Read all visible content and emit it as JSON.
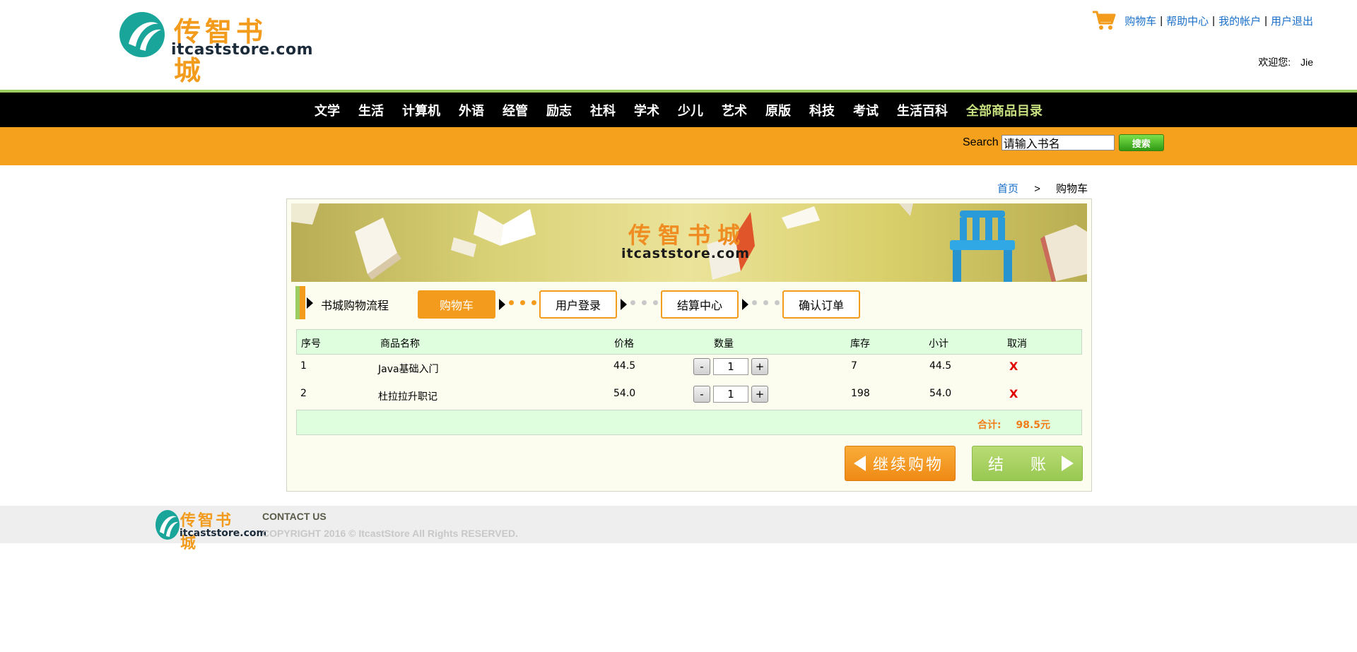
{
  "header": {
    "logo_cn": "传智书城",
    "logo_en": "itcaststore.com",
    "top_links": [
      "购物车",
      "帮助中心",
      "我的帐户",
      "用户退出"
    ],
    "welcome_label": "欢迎您:",
    "username": "Jie"
  },
  "categories": [
    "文学",
    "生活",
    "计算机",
    "外语",
    "经管",
    "励志",
    "社科",
    "学术",
    "少儿",
    "艺术",
    "原版",
    "科技",
    "考试",
    "生活百科",
    "全部商品目录"
  ],
  "search": {
    "label": "Search",
    "value": "请输入书名",
    "button": "搜索"
  },
  "breadcrumb": {
    "home": "首页",
    "separator": ">",
    "current": "购物车"
  },
  "banner": {
    "cn": "传智书城",
    "en": "itcaststore.com"
  },
  "flow": {
    "title": "书城购物流程",
    "steps": [
      "购物车",
      "用户登录",
      "结算中心",
      "确认订单"
    ]
  },
  "cart": {
    "columns": [
      "序号",
      "商品名称",
      "价格",
      "数量",
      "库存",
      "小计",
      "取消"
    ],
    "rows": [
      {
        "no": "1",
        "name": "Java基础入门",
        "price": "44.5",
        "qty": "1",
        "stock": "7",
        "subtotal": "44.5",
        "remove": "X"
      },
      {
        "no": "2",
        "name": "杜拉拉升职记",
        "price": "54.0",
        "qty": "1",
        "stock": "198",
        "subtotal": "54.0",
        "remove": "X"
      }
    ],
    "minus": "-",
    "plus": "+",
    "total_label": "合计:",
    "total_value": "98.5元"
  },
  "actions": {
    "continue": "继续购物",
    "checkout": "结　账"
  },
  "footer": {
    "logo_cn": "传智书城",
    "logo_en": "itcaststore.com",
    "contact": "CONTACT US",
    "copyright": "COPYRIGHT 2016 © ItcastStore All Rights RESERVED."
  },
  "colors": {
    "orange": "#f5a11e",
    "green": "#9ccd60",
    "link": "#1a6fc9",
    "table_header": "#defede",
    "remove": "#e00000"
  }
}
